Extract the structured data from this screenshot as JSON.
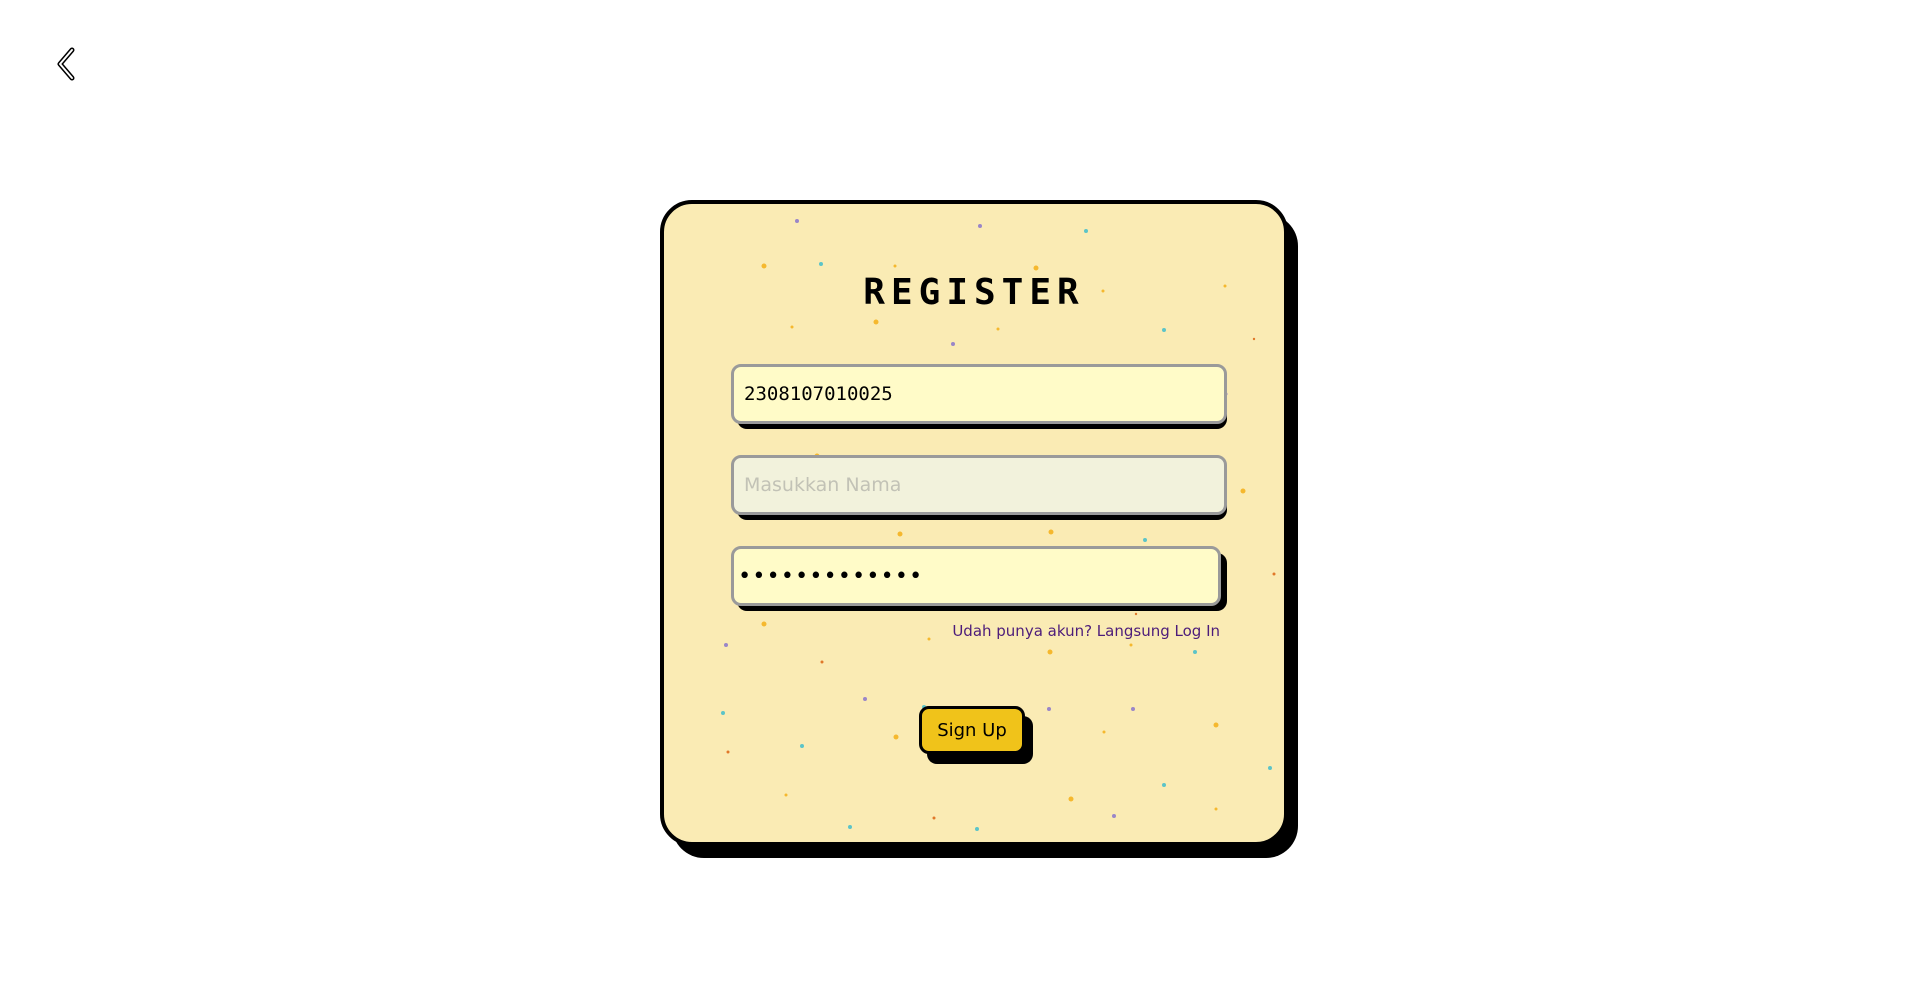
{
  "page": {
    "background_color": "#ffffff"
  },
  "nav": {
    "back_icon": "chevron-left-icon"
  },
  "register_card": {
    "title": "REGISTER",
    "card_color": "#faebb4",
    "accent_color": "#f0c31a",
    "link_color": "#4c1c7a",
    "fields": {
      "nim": {
        "value": "2308107010025",
        "placeholder": ""
      },
      "name": {
        "value": "",
        "placeholder": "Masukkan Nama"
      },
      "password": {
        "value": "•••••••••••••",
        "placeholder": ""
      }
    },
    "login_link_label": "Udah punya akun? Langsung Log In",
    "signup_label": "Sign Up"
  }
}
